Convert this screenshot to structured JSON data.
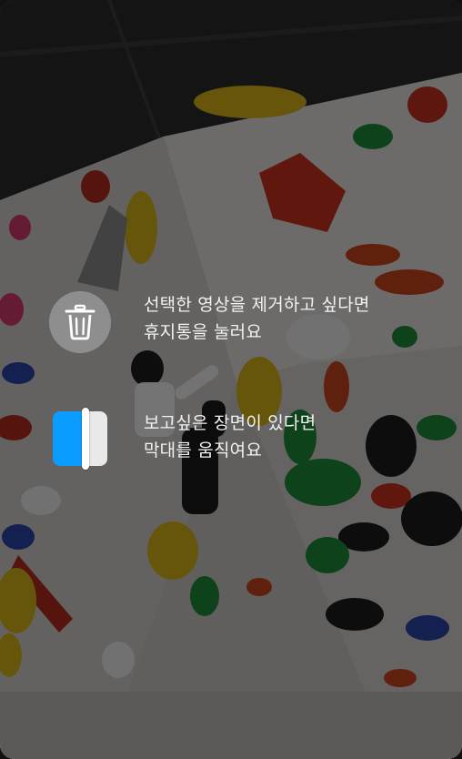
{
  "hints": {
    "delete": {
      "icon": "trash-icon",
      "line1": "선택한 영상을 제거하고 싶다면",
      "line2": "휴지통을 눌러요"
    },
    "scrub": {
      "icon": "timeline-handle-icon",
      "line1": "보고싶은 장면이 있다면",
      "line2": "막대를 움직여요"
    }
  },
  "colors": {
    "scrim": "rgba(0,0,0,0.52)",
    "trash_circle": "#8e8e8e",
    "scrub_accent": "#0a9cff",
    "text": "#f2f2f2"
  }
}
